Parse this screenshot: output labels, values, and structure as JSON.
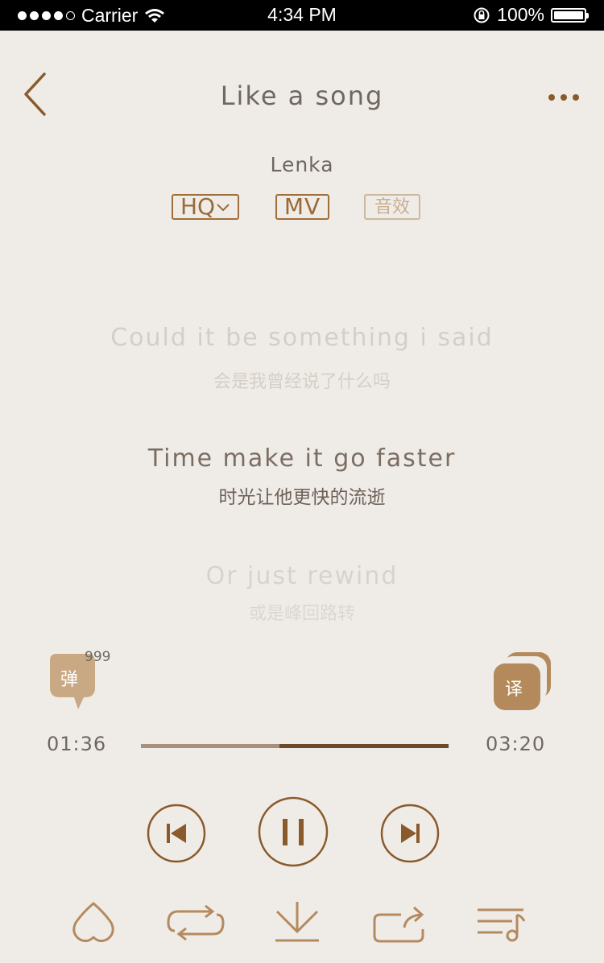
{
  "status_bar": {
    "carrier": "Carrier",
    "time": "4:34 PM",
    "battery_pct": "100%"
  },
  "header": {
    "title": "Like a song",
    "back_icon": "chevron-left-icon",
    "more_icon": "more-dots-icon"
  },
  "song": {
    "artist": "Lenka"
  },
  "tags": {
    "hq_label": "HQ",
    "mv_label": "MV",
    "effect_label": "音效"
  },
  "lyrics": [
    {
      "en": "Could it be something i said",
      "cn": "会是我曾经说了什么吗"
    },
    {
      "en": "Time make it go faster",
      "cn": "时光让他更快的流逝"
    },
    {
      "en": "Or just rewind",
      "cn": "或是峰回路转"
    }
  ],
  "danmu": {
    "label": "弹",
    "count": "999"
  },
  "translate": {
    "label": "译"
  },
  "playback": {
    "current": "01:36",
    "total": "03:20",
    "progress": 0.45
  },
  "controls": [
    "previous-icon",
    "pause-icon",
    "next-icon"
  ],
  "bottom_bar": [
    "like-heart-icon",
    "repeat-icon",
    "download-icon",
    "share-icon",
    "playlist-icon"
  ],
  "colors": {
    "accent": "#9a6a38",
    "background": "#efece8",
    "text": "#6f6760"
  }
}
